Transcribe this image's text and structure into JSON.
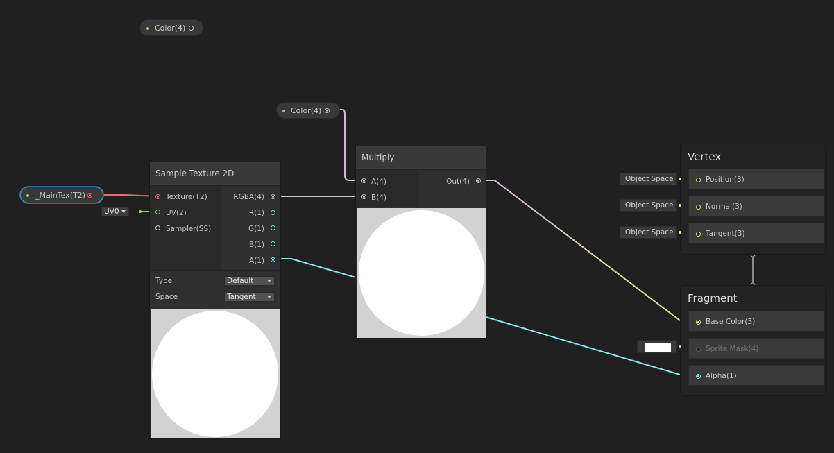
{
  "colors": {
    "background": "#202020",
    "color_wire": "#d8b8d8",
    "texture_wire": "#e0706e",
    "vector2_wire": "#8fd37a",
    "vector3_wire": "#e2e88a",
    "float_wire": "#84e4e7",
    "selection": "#4a8fb3"
  },
  "property_nodes": [
    {
      "label": "Color(4)"
    },
    {
      "label": "Color(4)"
    },
    {
      "label": "_MainTex(T2)"
    }
  ],
  "sample_texture": {
    "title": "Sample Texture 2D",
    "inputs": [
      "Texture(T2)",
      "UV(2)",
      "Sampler(SS)"
    ],
    "outputs": [
      "RGBA(4)",
      "R(1)",
      "G(1)",
      "B(1)",
      "A(1)"
    ],
    "uv_dropdown": "UV0",
    "settings": [
      {
        "label": "Type",
        "value": "Default"
      },
      {
        "label": "Space",
        "value": "Tangent"
      }
    ]
  },
  "multiply": {
    "title": "Multiply",
    "inputs": [
      "A(4)",
      "B(4)"
    ],
    "output": "Out(4)"
  },
  "vertex": {
    "title": "Vertex",
    "blocks": [
      {
        "label": "Position(3)",
        "space": "Object Space"
      },
      {
        "label": "Normal(3)",
        "space": "Object Space"
      },
      {
        "label": "Tangent(3)",
        "space": "Object Space"
      }
    ]
  },
  "fragment": {
    "title": "Fragment",
    "blocks": [
      {
        "label": "Base Color(3)"
      },
      {
        "label": "Sprite Mask(4)"
      },
      {
        "label": "Alpha(1)"
      }
    ]
  }
}
